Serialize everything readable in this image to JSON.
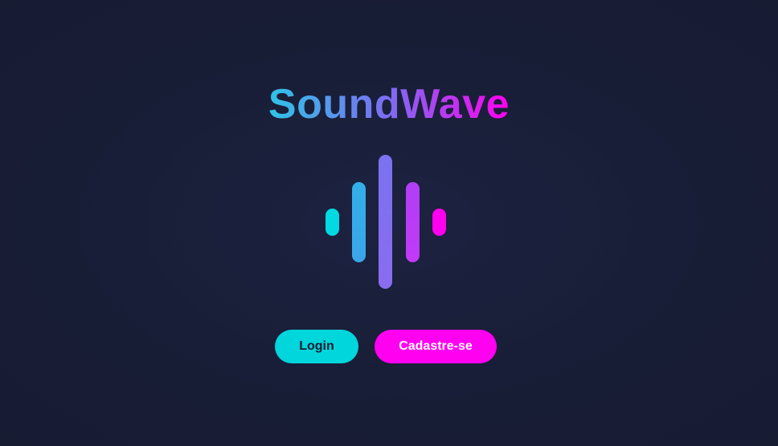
{
  "brand": {
    "title": "SoundWave",
    "gradient": [
      "#2fc4e6",
      "#7d6cf2",
      "#ff00f0"
    ]
  },
  "logo": {
    "icon": "sound-wave-icon",
    "bar_colors": [
      "#00d9e1",
      "#33aee8",
      "#7a72f0",
      "#b13ef6",
      "#ff00f0"
    ]
  },
  "actions": {
    "login_label": "Login",
    "signup_label": "Cadastre-se"
  },
  "colors": {
    "background": "#181d36",
    "login_button": "#00d6db",
    "signup_button": "#ff00f0"
  }
}
